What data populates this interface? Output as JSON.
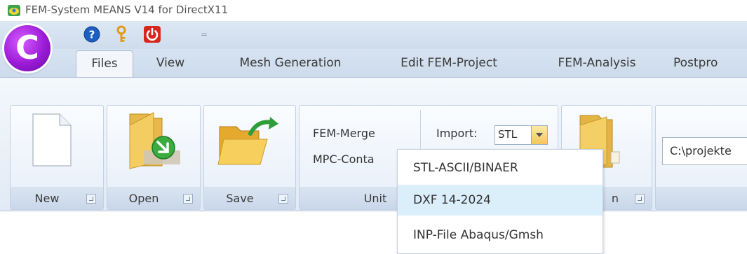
{
  "window": {
    "title": "FEM-System MEANS V14 for DirectX11",
    "icon": "app-icon"
  },
  "quick_access": {
    "items": [
      {
        "name": "help-icon",
        "color": "#1c5fc0"
      },
      {
        "name": "key-icon",
        "color": "#e09a18"
      },
      {
        "name": "power-icon",
        "color": "#d9261c"
      }
    ],
    "overflow": "="
  },
  "orb": {
    "letter": "C",
    "color": "#9b1bd6"
  },
  "tabs": [
    {
      "label": "Files",
      "active": true
    },
    {
      "label": "View"
    },
    {
      "label": "Mesh Generation"
    },
    {
      "label": "Edit FEM-Project"
    },
    {
      "label": "FEM-Analysis"
    },
    {
      "label": "Postpro"
    }
  ],
  "ribbon": {
    "groups": {
      "new": {
        "label": "New"
      },
      "open": {
        "label": "Open"
      },
      "save": {
        "label": "Save"
      },
      "unit": {
        "label": "Unit",
        "items": [
          "FEM-Merge",
          "MPC-Conta"
        ]
      },
      "import": {
        "label": "Import:",
        "value": "STL"
      },
      "folder": {
        "label": "n"
      }
    },
    "path": "C:\\projekte"
  },
  "import_dropdown": {
    "options": [
      {
        "label": "STL-ASCII/BINAER"
      },
      {
        "label": "DXF 14-2024",
        "highlighted": true
      },
      {
        "label": "INP-File Abaqus/Gmsh"
      }
    ]
  }
}
